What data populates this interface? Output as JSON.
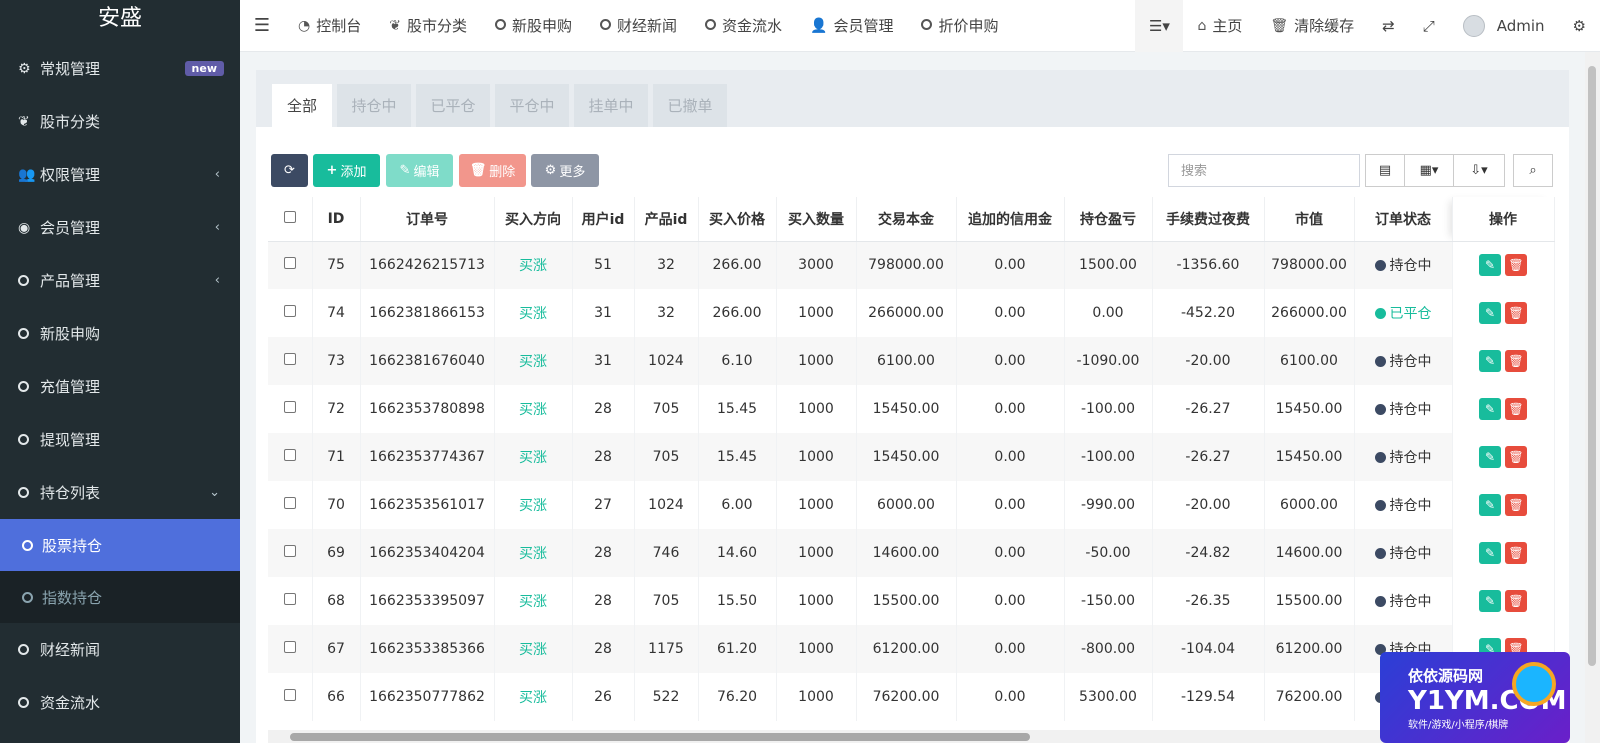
{
  "brand": "安盛",
  "sidebar": {
    "items": [
      {
        "label": "常规管理",
        "icon": "cogs-icon",
        "badge": "new"
      },
      {
        "label": "股市分类",
        "icon": "leaf-icon"
      },
      {
        "label": "权限管理",
        "icon": "users-icon",
        "caret": "‹"
      },
      {
        "label": "会员管理",
        "icon": "user-circle-icon",
        "caret": "‹"
      },
      {
        "label": "产品管理",
        "icon": "circle-icon",
        "caret": "‹"
      },
      {
        "label": "新股申购",
        "icon": "circle-icon"
      },
      {
        "label": "充值管理",
        "icon": "circle-icon"
      },
      {
        "label": "提现管理",
        "icon": "circle-icon"
      },
      {
        "label": "持仓列表",
        "icon": "circle-icon",
        "caret": "⌄"
      }
    ],
    "sub_items": [
      {
        "label": "股票持仓",
        "state": "active"
      },
      {
        "label": "指数持仓",
        "state": "dim"
      }
    ],
    "tail_items": [
      {
        "label": "财经新闻",
        "icon": "circle-icon"
      },
      {
        "label": "资金流水",
        "icon": "circle-icon"
      }
    ]
  },
  "topbar": {
    "nav": [
      {
        "label": "控制台",
        "icon": "dashboard-icon"
      },
      {
        "label": "股市分类",
        "icon": "leaf-icon"
      },
      {
        "label": "新股申购",
        "icon": "circle-icon"
      },
      {
        "label": "财经新闻",
        "icon": "circle-icon"
      },
      {
        "label": "资金流水",
        "icon": "circle-icon"
      },
      {
        "label": "会员管理",
        "icon": "user-icon"
      },
      {
        "label": "折价申购",
        "icon": "circle-icon"
      }
    ],
    "home": "主页",
    "clear_cache": "清除缓存",
    "user": "Admin"
  },
  "tabs": [
    "全部",
    "持仓中",
    "已平仓",
    "平仓中",
    "挂单中",
    "已撤单"
  ],
  "toolbar": {
    "add": "添加",
    "edit": "编辑",
    "delete": "删除",
    "more": "更多",
    "search_placeholder": "搜索",
    "colors": {
      "refresh": "#3c4a63",
      "add": "#18bc9c",
      "edit": "#7fdcc9",
      "delete": "#f2968c",
      "more": "#8e96a5"
    }
  },
  "table": {
    "headers": [
      "ID",
      "订单号",
      "买入方向",
      "用户id",
      "产品id",
      "买入价格",
      "买入数量",
      "交易本金",
      "追加的信用金",
      "持仓盈亏",
      "手续费过夜费",
      "市值",
      "订单状态",
      "操作"
    ],
    "rows": [
      [
        "75",
        "1662426215713",
        "买涨",
        "51",
        "32",
        "266.00",
        "3000",
        "798000.00",
        "0.00",
        "1500.00",
        "-1356.60",
        "798000.00",
        "持仓中"
      ],
      [
        "74",
        "1662381866153",
        "买涨",
        "31",
        "32",
        "266.00",
        "1000",
        "266000.00",
        "0.00",
        "0.00",
        "-452.20",
        "266000.00",
        "已平仓"
      ],
      [
        "73",
        "1662381676040",
        "买涨",
        "31",
        "1024",
        "6.10",
        "1000",
        "6100.00",
        "0.00",
        "-1090.00",
        "-20.00",
        "6100.00",
        "持仓中"
      ],
      [
        "72",
        "1662353780898",
        "买涨",
        "28",
        "705",
        "15.45",
        "1000",
        "15450.00",
        "0.00",
        "-100.00",
        "-26.27",
        "15450.00",
        "持仓中"
      ],
      [
        "71",
        "1662353774367",
        "买涨",
        "28",
        "705",
        "15.45",
        "1000",
        "15450.00",
        "0.00",
        "-100.00",
        "-26.27",
        "15450.00",
        "持仓中"
      ],
      [
        "70",
        "1662353561017",
        "买涨",
        "27",
        "1024",
        "6.00",
        "1000",
        "6000.00",
        "0.00",
        "-990.00",
        "-20.00",
        "6000.00",
        "持仓中"
      ],
      [
        "69",
        "1662353404204",
        "买涨",
        "28",
        "746",
        "14.60",
        "1000",
        "14600.00",
        "0.00",
        "-50.00",
        "-24.82",
        "14600.00",
        "持仓中"
      ],
      [
        "68",
        "1662353395097",
        "买涨",
        "28",
        "705",
        "15.50",
        "1000",
        "15500.00",
        "0.00",
        "-150.00",
        "-26.35",
        "15500.00",
        "持仓中"
      ],
      [
        "67",
        "1662353385366",
        "买涨",
        "28",
        "1175",
        "61.20",
        "1000",
        "61200.00",
        "0.00",
        "-800.00",
        "-104.04",
        "61200.00",
        "持仓中"
      ],
      [
        "66",
        "1662350777862",
        "买涨",
        "26",
        "522",
        "76.20",
        "1000",
        "76200.00",
        "0.00",
        "5300.00",
        "-129.54",
        "76200.00",
        "持仓中"
      ]
    ]
  },
  "watermark": {
    "line1": "依依源码网",
    "line2": "Y1YM.COM",
    "line3": "软件/游戏/小程序/棋牌"
  }
}
